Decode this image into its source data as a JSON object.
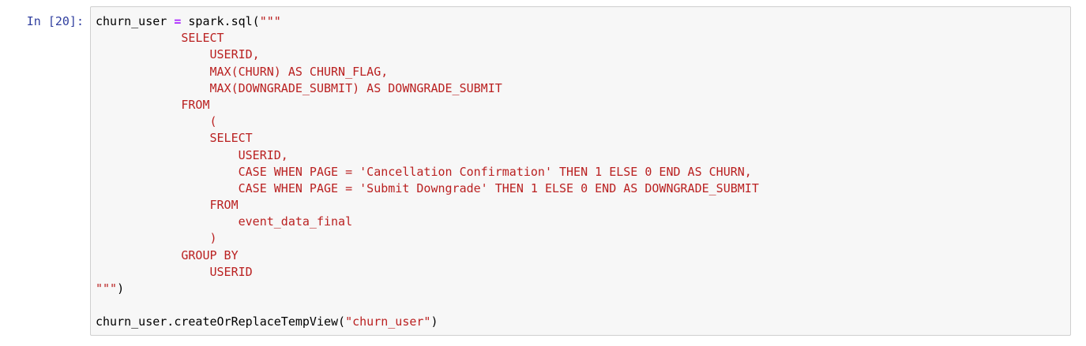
{
  "prompt": "In [20]:",
  "colors": {
    "prompt": "#303f9f",
    "string": "#ba2121",
    "operator": "#aa22ff",
    "cell_bg": "#f7f7f7",
    "cell_border": "#cfcfcf"
  },
  "code": {
    "line1": {
      "var": "churn_user",
      "eq": " = ",
      "op": "=",
      "call": "spark.sql(",
      "str_open": "\"\"\""
    },
    "sql_lines": [
      "            SELECT",
      "                USERID,",
      "                MAX(CHURN) AS CHURN_FLAG,",
      "                MAX(DOWNGRADE_SUBMIT) AS DOWNGRADE_SUBMIT",
      "            FROM",
      "                (",
      "                SELECT",
      "                    USERID,",
      "                    CASE WHEN PAGE = 'Cancellation Confirmation' THEN 1 ELSE 0 END AS CHURN,",
      "                    CASE WHEN PAGE = 'Submit Downgrade' THEN 1 ELSE 0 END AS DOWNGRADE_SUBMIT",
      "                FROM",
      "                    event_data_final",
      "                )",
      "            GROUP BY",
      "                USERID"
    ],
    "str_close": "\"\"\"",
    "close_paren": ")",
    "last_line": {
      "obj": "churn_user.createOrReplaceTempView(",
      "arg": "\"churn_user\"",
      "close": ")"
    }
  }
}
